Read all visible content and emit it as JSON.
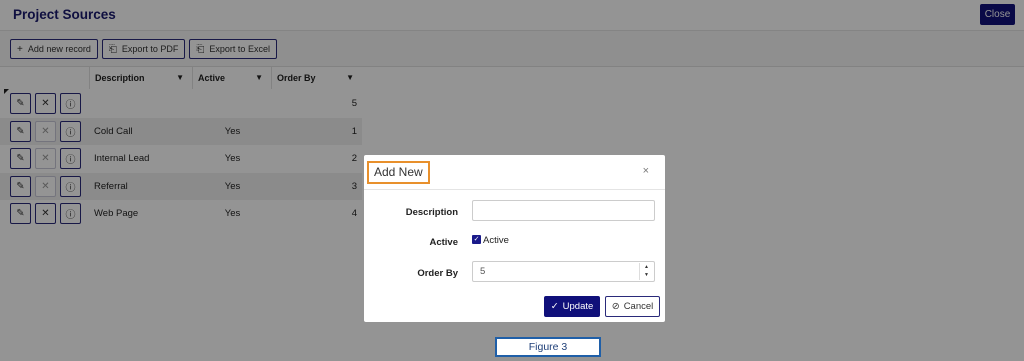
{
  "page": {
    "title": "Project Sources",
    "close_label": "Close"
  },
  "toolbar": {
    "add_label": "Add new record",
    "add_icon": "+",
    "pdf_label": "Export to PDF",
    "pdf_icon": "⎗",
    "excel_label": "Export to Excel",
    "excel_icon": "⎗"
  },
  "grid": {
    "columns": {
      "description": "Description",
      "active": "Active",
      "order_by": "Order By"
    },
    "filter_icon": "▼",
    "edit_icon": "✎",
    "delete_icon": "✕",
    "info_icon": "ⓘ",
    "rows": [
      {
        "description": "",
        "active": "",
        "order_by": "5"
      },
      {
        "description": "Cold Call",
        "active": "Yes",
        "order_by": "1"
      },
      {
        "description": "Internal Lead",
        "active": "Yes",
        "order_by": "2"
      },
      {
        "description": "Referral",
        "active": "Yes",
        "order_by": "3"
      },
      {
        "description": "Web Page",
        "active": "Yes",
        "order_by": "4"
      }
    ]
  },
  "modal": {
    "title": "Add New",
    "close_icon": "×",
    "description_label": "Description",
    "description_value": "",
    "active_label": "Active",
    "active_checkbox_label": "Active",
    "active_checked": true,
    "check_icon": "✓",
    "order_label": "Order By",
    "order_value": "5",
    "spin_up": "▲",
    "spin_down": "▼",
    "update_label": "Update",
    "update_icon": "✓",
    "cancel_label": "Cancel",
    "cancel_icon": "⊘"
  },
  "figure_caption": "Figure 3",
  "colors": {
    "accent": "#10107a",
    "highlight": "#e8902c",
    "caption_border": "#1f5fa8"
  }
}
